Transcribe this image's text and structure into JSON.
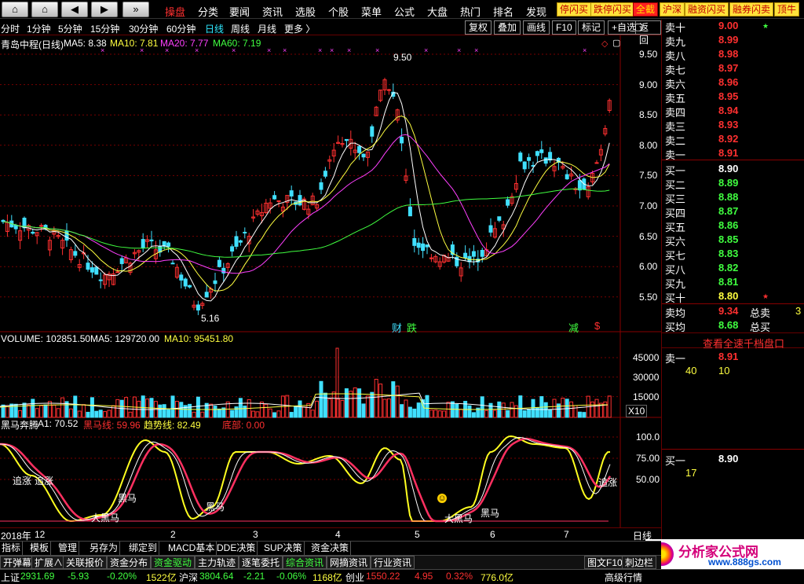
{
  "nav": {
    "home": "⌂",
    "back": "◀",
    "forward": "▶",
    "down": "»"
  },
  "menu": [
    {
      "label": "操盘",
      "active": true
    },
    {
      "label": "分类"
    },
    {
      "label": "要闻"
    },
    {
      "label": "资讯"
    },
    {
      "label": "选股"
    },
    {
      "label": "个股"
    },
    {
      "label": "菜单"
    },
    {
      "label": "公式"
    },
    {
      "label": "大盘"
    },
    {
      "label": "热门"
    },
    {
      "label": "排名"
    },
    {
      "label": "发现"
    }
  ],
  "toolbuttons": [
    "停闪买",
    "跌停闪买",
    "全截",
    "沪深",
    "融资闪买",
    "融券闪卖",
    "顶牛"
  ],
  "periods": [
    {
      "label": "分时"
    },
    {
      "label": "1分钟"
    },
    {
      "label": "5分钟"
    },
    {
      "label": "15分钟"
    },
    {
      "label": "30分钟"
    },
    {
      "label": "60分钟"
    },
    {
      "label": "日线",
      "selected": true
    },
    {
      "label": "周线"
    },
    {
      "label": "月线"
    },
    {
      "label": "更多 〉"
    }
  ],
  "chart_tools": [
    "复权",
    "叠加",
    "画线",
    "F10",
    "标记",
    "+自选",
    "返回"
  ],
  "price_legend": {
    "name": "青岛中程(日线)",
    "ma5": "MA5: 8.38",
    "ma10": "MA10: 7.81",
    "ma20": "MA20: 7.77",
    "ma60": "MA60: 7.19"
  },
  "price_axis": [
    "9.50",
    "9.00",
    "8.50",
    "8.00",
    "7.50",
    "7.00",
    "6.50",
    "6.00",
    "5.50"
  ],
  "annotations": {
    "high": "9.50",
    "low": "5.16",
    "cai": "财",
    "die": "跌",
    "jian": "减",
    "dollar": "$"
  },
  "volume_legend": {
    "name": "VOLUME: 102851.50",
    "ma5": "MA5: 129720.00",
    "ma10": "MA10: 95451.80"
  },
  "volume_axis": [
    "45000",
    "30000",
    "15000"
  ],
  "volume_unit": "X10",
  "ind_legend": {
    "name": "黑马奔腾",
    "a1": "A1: 70.52",
    "hm": "黑马线: 59.96",
    "trend": "趋势线: 82.49",
    "bottom": "底部: 0.00"
  },
  "ind_axis": [
    "100.0",
    "75.00",
    "50.00"
  ],
  "ind_labels": {
    "chase1": "追涨",
    "chase2": "追涨",
    "hm1": "黑马",
    "hm2": "大黑马",
    "hm3": "黑马",
    "hm4": "大黑马",
    "hm5": "黑马",
    "chase3": "追涨"
  },
  "x_axis": {
    "year": "2018年",
    "m12": "12",
    "m2": "2",
    "m3": "3",
    "m4": "4",
    "m5": "5",
    "m6": "6",
    "m7": "7",
    "period": "日线"
  },
  "quote": {
    "asks": [
      {
        "name": "卖十",
        "price": "9.00",
        "mark": "★"
      },
      {
        "name": "卖九",
        "price": "8.99"
      },
      {
        "name": "卖八",
        "price": "8.98"
      },
      {
        "name": "卖七",
        "price": "8.97"
      },
      {
        "name": "卖六",
        "price": "8.96"
      },
      {
        "name": "卖五",
        "price": "8.95"
      },
      {
        "name": "卖四",
        "price": "8.94"
      },
      {
        "name": "卖三",
        "price": "8.93"
      },
      {
        "name": "卖二",
        "price": "8.92"
      },
      {
        "name": "卖一",
        "price": "8.91"
      }
    ],
    "bids": [
      {
        "name": "买一",
        "price": "8.90"
      },
      {
        "name": "买二",
        "price": "8.89"
      },
      {
        "name": "买三",
        "price": "8.88"
      },
      {
        "name": "买四",
        "price": "8.87"
      },
      {
        "name": "买五",
        "price": "8.86"
      },
      {
        "name": "买六",
        "price": "8.85"
      },
      {
        "name": "买七",
        "price": "8.83"
      },
      {
        "name": "买八",
        "price": "8.82"
      },
      {
        "name": "买九",
        "price": "8.81"
      },
      {
        "name": "买十",
        "price": "8.80",
        "mark": "★"
      }
    ],
    "avg_sell_label": "卖均",
    "avg_sell": "9.34",
    "total_sell_label": "总卖",
    "total_sell_val": "3",
    "avg_buy_label": "买均",
    "avg_buy": "8.68",
    "total_buy_label": "总买",
    "link": "查看全速千档盘口",
    "ask1_label": "卖一",
    "ask1_price": "8.91",
    "ask1_qty_a": "40",
    "ask1_qty_b": "10",
    "bid1_label": "买一",
    "bid1_price": "8.90",
    "bid1_qty": "17"
  },
  "bottom_tabs": [
    "指标",
    "模板",
    "管理",
    "另存为",
    "绑定到",
    "MACD基本",
    "DDE决策",
    "SUP决策",
    "资金决策"
  ],
  "bottom_tabs2": [
    "开弹幕",
    "扩展∧",
    "关联报价",
    "资金分布",
    "资金驱动",
    "主力轨迹",
    "逐笔委托",
    "综合资讯",
    "网摘资讯",
    "行业资讯"
  ],
  "bottom_right": [
    "图文F10",
    "刺边栏"
  ],
  "status": {
    "sh_label": "上证",
    "sh": "2931.69",
    "sh_chg": "-5.93",
    "sh_pct": "-0.20%",
    "sh_amt": "1522亿",
    "sz_label": "沪深",
    "sz": "3804.64",
    "sz_chg": "-2.21",
    "sz_pct": "-0.06%",
    "sz_amt": "1168亿",
    "cy_label": "创业",
    "cy": "1550.22",
    "cy_chg": "4.95",
    "cy_pct": "0.32%",
    "cy_amt": "776.0亿",
    "hq": "高级行情"
  },
  "watermark": {
    "site": "分析家公式网",
    "url": "www.888gs.com"
  },
  "colors": {
    "up": "#ff3030",
    "down": "#40e0ff",
    "ma5": "#ffffff",
    "ma10": "#ffff40",
    "ma20": "#ff40ff",
    "ma60": "#40ff40"
  },
  "chart_data": {
    "type": "candlestick",
    "price_range": [
      5.16,
      9.5
    ],
    "ma_lines": {
      "MA5": 8.38,
      "MA10": 7.81,
      "MA20": 7.77,
      "MA60": 7.19
    }
  }
}
